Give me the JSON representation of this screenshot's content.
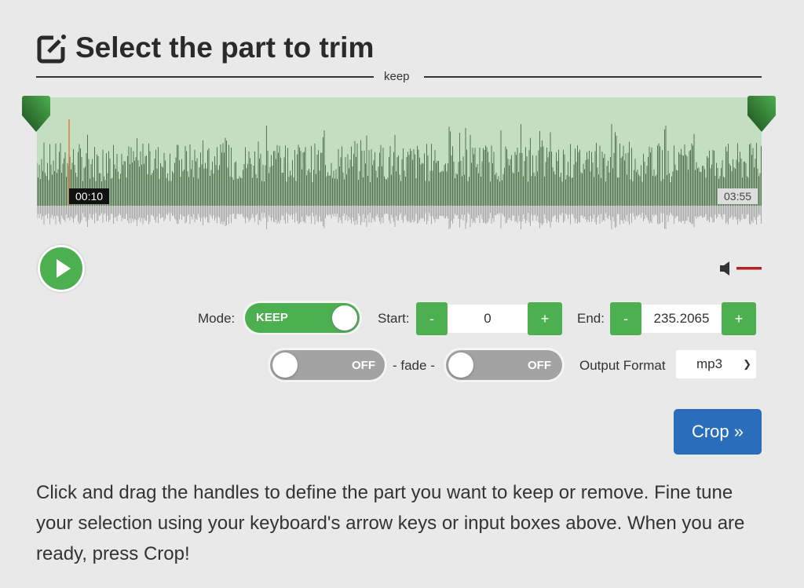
{
  "header": {
    "title": "Select the part to trim",
    "icon": "edit-icon",
    "divider_label": "keep"
  },
  "waveform": {
    "current_time": "00:10",
    "duration": "03:55",
    "selection_color": "#c3dec0",
    "wave_color": "#3a5a38",
    "cursor_color": "#e08040"
  },
  "player": {
    "play_icon": "play-icon",
    "volume_icon": "speaker-icon",
    "volume_muted_color": "#b22222"
  },
  "controls": {
    "mode_label": "Mode:",
    "mode_value": "KEEP",
    "start_label": "Start:",
    "start_value": "0",
    "end_label": "End:",
    "end_value": "235.2065",
    "minus": "-",
    "plus": "+",
    "fade_in": "OFF",
    "fade_label": "- fade -",
    "fade_out": "OFF",
    "format_label": "Output Format",
    "format_value": "mp3"
  },
  "crop_button": "Crop »",
  "help_text": "Click and drag the handles to define the part you want to keep or remove. Fine tune your selection using your keyboard's arrow keys or input boxes above. When you are ready, press Crop!",
  "accent": "#4caf50",
  "button_color": "#2a6ebb"
}
